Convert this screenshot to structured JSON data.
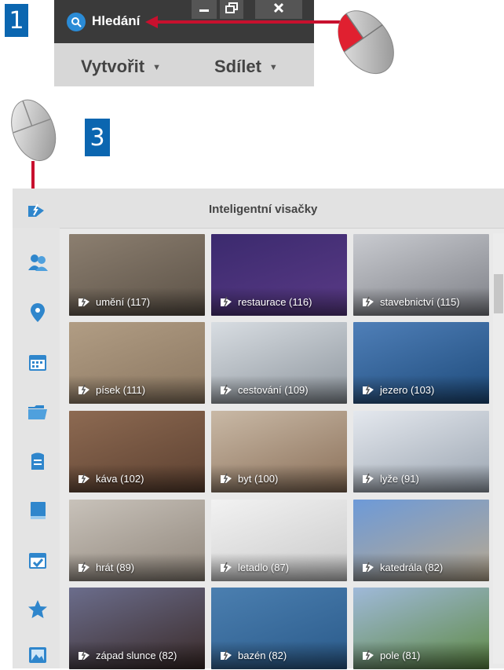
{
  "badges": {
    "step1": "1",
    "step3": "3"
  },
  "toolbar": {
    "search_label": "Hledání",
    "create_label": "Vytvořit",
    "share_label": "Sdílet",
    "window_buttons": [
      "minimize-icon",
      "restore-icon",
      "close-icon"
    ]
  },
  "panel": {
    "title": "Inteligentní visačky",
    "sidebar_icons": [
      "smart-tags-icon",
      "people-icon",
      "places-icon",
      "calendar-icon",
      "folders-icon",
      "albums-icon",
      "book-icon",
      "events-icon",
      "favorites-icon",
      "photos-icon"
    ]
  },
  "tiles": [
    {
      "label": "umění (117)",
      "colors": [
        "#8c7f70",
        "#5b5146"
      ]
    },
    {
      "label": "restaurace (116)",
      "colors": [
        "#3b2a6e",
        "#5a3a86"
      ]
    },
    {
      "label": "stavebnictví (115)",
      "colors": [
        "#c9cbd0",
        "#7d7f86"
      ]
    },
    {
      "label": "písek (111)",
      "colors": [
        "#b19d84",
        "#8a7660"
      ]
    },
    {
      "label": "cestování (109)",
      "colors": [
        "#d8dde2",
        "#8d959d"
      ]
    },
    {
      "label": "jezero (103)",
      "colors": [
        "#4f7fb8",
        "#1d4a7a"
      ]
    },
    {
      "label": "káva (102)",
      "colors": [
        "#8d6a52",
        "#5c4030"
      ]
    },
    {
      "label": "byt (100)",
      "colors": [
        "#c9b9a6",
        "#8a6f58"
      ]
    },
    {
      "label": "lyže (91)",
      "colors": [
        "#e4e8ee",
        "#9aa4b0"
      ]
    },
    {
      "label": "hrát (89)",
      "colors": [
        "#c8c2ba",
        "#8f857a"
      ]
    },
    {
      "label": "letadlo (87)",
      "colors": [
        "#f2f2f2",
        "#c9c9c9"
      ]
    },
    {
      "label": "katedrála (82)",
      "colors": [
        "#6d9ad8",
        "#b9a98f"
      ]
    },
    {
      "label": "západ slunce (82)",
      "colors": [
        "#6b6d8c",
        "#3a2a28"
      ]
    },
    {
      "label": "bazén (82)",
      "colors": [
        "#4b7fb0",
        "#2a5a8a"
      ]
    },
    {
      "label": "pole (81)",
      "colors": [
        "#9fb9d9",
        "#5f8a44"
      ]
    }
  ],
  "colors": {
    "accent": "#0b66b0",
    "arrow": "#c8102e",
    "search_icon": "#2a8bd6"
  }
}
